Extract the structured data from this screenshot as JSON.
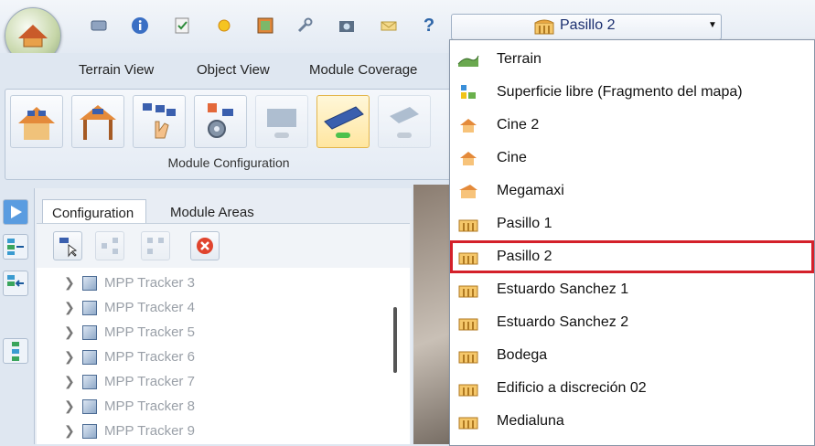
{
  "ribbon_tabs": [
    "Terrain View",
    "Object View",
    "Module Coverage"
  ],
  "ribbon_group_label": "Module Configuration",
  "panel_tabs": [
    "Configuration",
    "Module Areas"
  ],
  "tree_items": [
    "MPP Tracker 3",
    "MPP Tracker 4",
    "MPP Tracker 5",
    "MPP Tracker 6",
    "MPP Tracker 7",
    "MPP Tracker 8",
    "MPP Tracker 9"
  ],
  "building_selector": {
    "selected": "Pasillo 2",
    "options": [
      {
        "label": "Terrain",
        "icon": "terrain-icon"
      },
      {
        "label": "Superficie libre (Fragmento del mapa)",
        "icon": "free-surface-icon"
      },
      {
        "label": "Cine 2",
        "icon": "house-icon"
      },
      {
        "label": "Cine",
        "icon": "house-icon"
      },
      {
        "label": "Megamaxi",
        "icon": "house-icon"
      },
      {
        "label": "Pasillo 1",
        "icon": "open-building-icon"
      },
      {
        "label": "Pasillo 2",
        "icon": "open-building-icon"
      },
      {
        "label": "Estuardo Sanchez 1",
        "icon": "open-building-icon"
      },
      {
        "label": "Estuardo Sanchez 2",
        "icon": "open-building-icon"
      },
      {
        "label": "Bodega",
        "icon": "open-building-icon"
      },
      {
        "label": "Edificio a discreción 02",
        "icon": "open-building-icon"
      },
      {
        "label": "Medialuna",
        "icon": "open-building-icon"
      }
    ],
    "highlight_color": "#d4202a"
  },
  "help_glyph": "?"
}
